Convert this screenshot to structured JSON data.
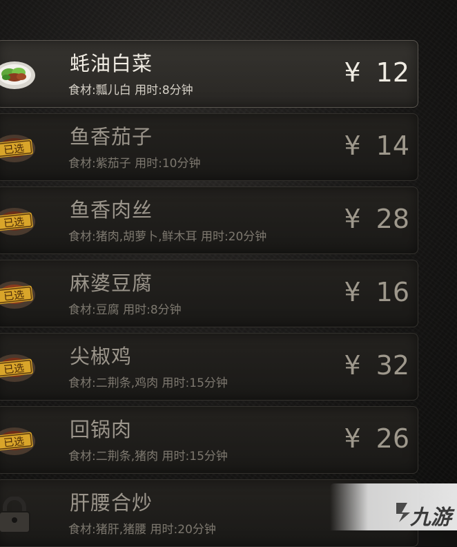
{
  "currency": "¥",
  "dishes": [
    {
      "name": "蚝油白菜",
      "meta": "食材:瓢儿白  用时:8分钟",
      "price": "12",
      "status": "available"
    },
    {
      "name": "鱼香茄子",
      "meta": "食材:紫茄子  用时:10分钟",
      "price": "14",
      "status": "selected"
    },
    {
      "name": "鱼香肉丝",
      "meta": "食材:猪肉,胡萝卜,鲜木耳  用时:20分钟",
      "price": "28",
      "status": "selected"
    },
    {
      "name": "麻婆豆腐",
      "meta": "食材:豆腐  用时:8分钟",
      "price": "16",
      "status": "selected"
    },
    {
      "name": "尖椒鸡",
      "meta": "食材:二荆条,鸡肉  用时:15分钟",
      "price": "32",
      "status": "selected"
    },
    {
      "name": "回锅肉",
      "meta": "食材:二荆条,猪肉  用时:15分钟",
      "price": "26",
      "status": "selected"
    },
    {
      "name": "肝腰合炒",
      "meta": "食材:猪肝,猪腰  用时:20分钟",
      "price": "",
      "status": "locked"
    }
  ],
  "selected_stamp": "已选",
  "watermark": "九游",
  "icons": {
    "dish": "dish-icon",
    "selected": "selected-stamp-icon",
    "locked": "lock-icon"
  }
}
